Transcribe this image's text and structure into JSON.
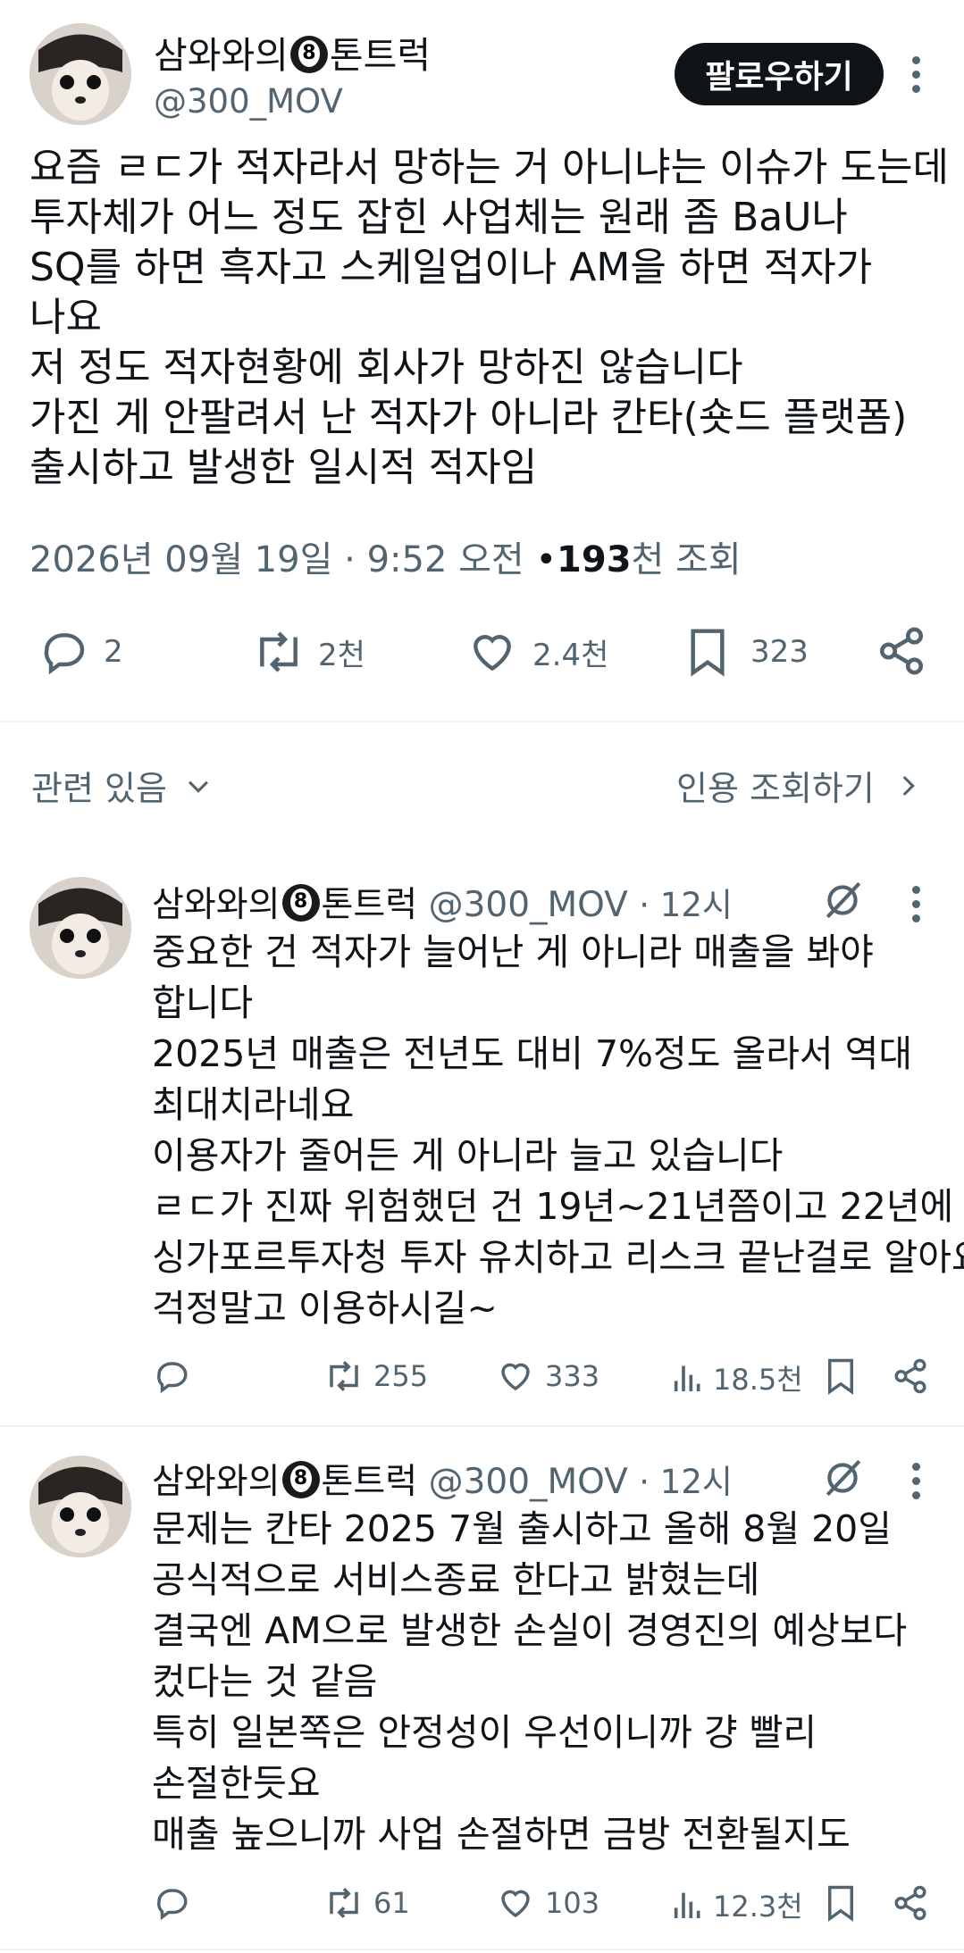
{
  "main_post": {
    "author_name": "삼와와의",
    "author_name_suffix": "톤트럭",
    "handle": "@300_MOV",
    "follow_label": "팔로우하기",
    "lines": [
      "요즘 ㄹㄷ가 적자라서 망하는 거 아니냐는 이슈가 도는데",
      "투자체가 어느 정도 잡힌 사업체는 원래 좀 BaU나",
      "SQ를 하면 흑자고 스케일업이나 AM을 하면 적자가",
      "나요",
      "저 정도 적자현황에 회사가 망하진 않습니다",
      "가진 게 안팔려서 난 적자가 아니라 칸타(숏드 플랫폼)",
      "출시하고 발생한 일시적 적자임"
    ],
    "date": "2026년 09월 19일 · 9:52 오전",
    "views_bullet": "•",
    "views_number": "193",
    "views_suffix": "천 조회",
    "replies": "2",
    "reposts": "2천",
    "likes": "2.4천",
    "bookmarks": "323"
  },
  "filter_bar": {
    "relevance_label": "관련 있음",
    "quotes_label": "인용 조회하기"
  },
  "replies": [
    {
      "author_name": "삼와와의",
      "author_name_suffix": "톤트럭",
      "handle": "@300_MOV",
      "time": "· 12시",
      "lines": [
        "중요한 건 적자가 늘어난 게 아니라 매출을 봐야",
        "합니다",
        "2025년 매출은 전년도 대비 7%정도 올라서 역대",
        "최대치라네요",
        "이용자가 줄어든 게 아니라 늘고 있습니다",
        "ㄹㄷ가 진짜 위험했던 건 19년~21년쯤이고 22년에",
        "싱가포르투자청 투자 유치하고 리스크 끝난걸로 알아요",
        "걱정말고 이용하시길~"
      ],
      "replies": "",
      "reposts": "255",
      "likes": "333",
      "views": "18.5천"
    },
    {
      "author_name": "삼와와의",
      "author_name_suffix": "톤트럭",
      "handle": "@300_MOV",
      "time": "· 12시",
      "lines": [
        "문제는 칸타 2025 7월 출시하고 올해 8월 20일",
        "공식적으로 서비스종료 한다고 밝혔는데",
        "결국엔 AM으로 발생한 손실이 경영진의 예상보다",
        "컸다는 것 같음",
        "특히 일본쪽은 안정성이 우선이니까 걍 빨리",
        "손절한듯요",
        "매출 높으니까 사업 손절하면 금방 전환될지도"
      ],
      "replies": "",
      "reposts": "61",
      "likes": "103",
      "views": "12.3천"
    }
  ]
}
